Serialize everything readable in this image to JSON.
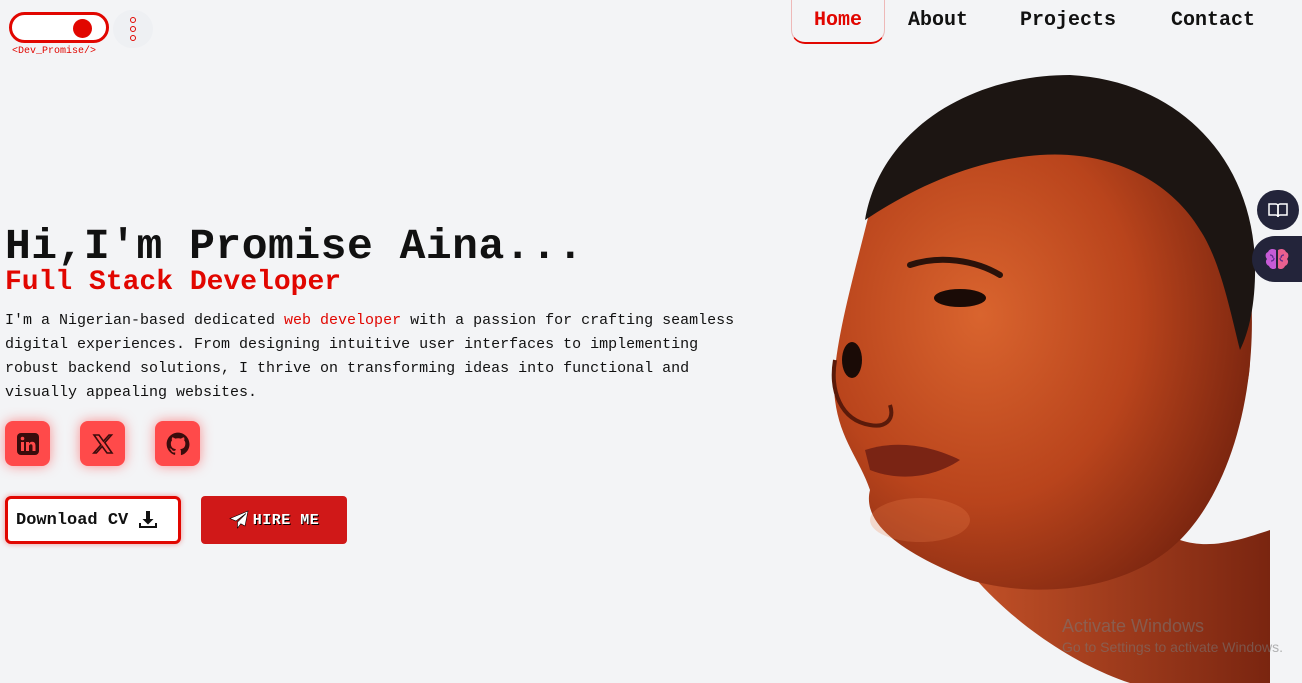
{
  "header": {
    "logo_text": "<Dev_Promise/>",
    "nav": [
      {
        "label": "Home",
        "active": true
      },
      {
        "label": "About"
      },
      {
        "label": "Projects"
      },
      {
        "label": "Contact"
      }
    ]
  },
  "hero": {
    "title": "Hi,I'm Promise Aina...",
    "role": "Full Stack Developer",
    "desc_before": "I'm a Nigerian-based dedicated ",
    "desc_highlight": "web developer",
    "desc_after": " with a passion for crafting seamless digital experiences. From designing intuitive user interfaces to implementing robust backend solutions, I thrive on transforming ideas into functional and visually appealing websites."
  },
  "socials": [
    {
      "icon": "linkedin-icon"
    },
    {
      "icon": "x-twitter-icon"
    },
    {
      "icon": "github-icon"
    }
  ],
  "buttons": {
    "download_cv": "Download CV",
    "hire_me": "HIRE ME"
  },
  "watermark": {
    "line1": "Activate Windows",
    "line2": "Go to Settings to activate Windows."
  },
  "colors": {
    "accent": "#e10600",
    "background": "#f3f4f6",
    "social_bg": "#ff4a4a",
    "hire_bg": "#d01818"
  }
}
